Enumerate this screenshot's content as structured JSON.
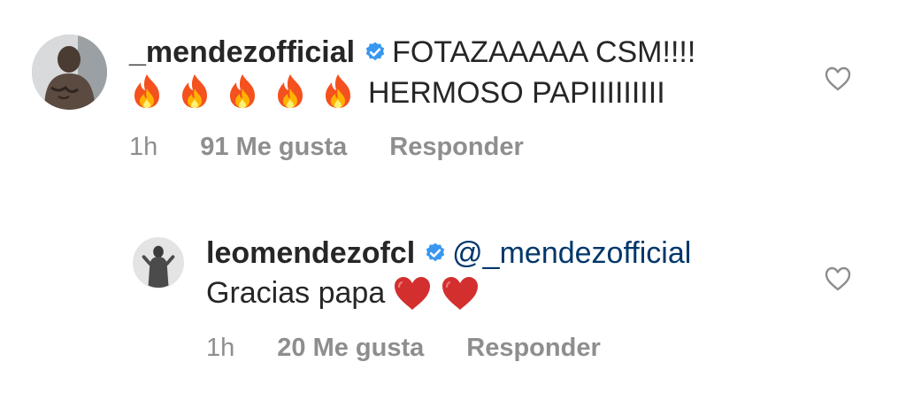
{
  "comments": [
    {
      "username": "_mendezofficial",
      "text_line1": "FOTAZAAAAA CSM!!!!",
      "text_line2": "HERMOSO PAPIIIIIIIII",
      "emoji_count": 5,
      "time": "1h",
      "likes": "91 Me gusta",
      "reply": "Responder"
    },
    {
      "username": "leomendezofcl",
      "mention": "@_mendezofficial",
      "text": "Gracias papa",
      "time": "1h",
      "likes": "20 Me gusta",
      "reply": "Responder"
    }
  ],
  "icons": {
    "verified": "verified-badge-icon",
    "fire": "fire-emoji-icon",
    "heart_emoji": "red-heart-emoji-icon",
    "like": "heart-outline-icon"
  },
  "colors": {
    "text": "#262626",
    "muted": "#8e8e8e",
    "mention": "#00376b",
    "verified": "#3897f0"
  }
}
